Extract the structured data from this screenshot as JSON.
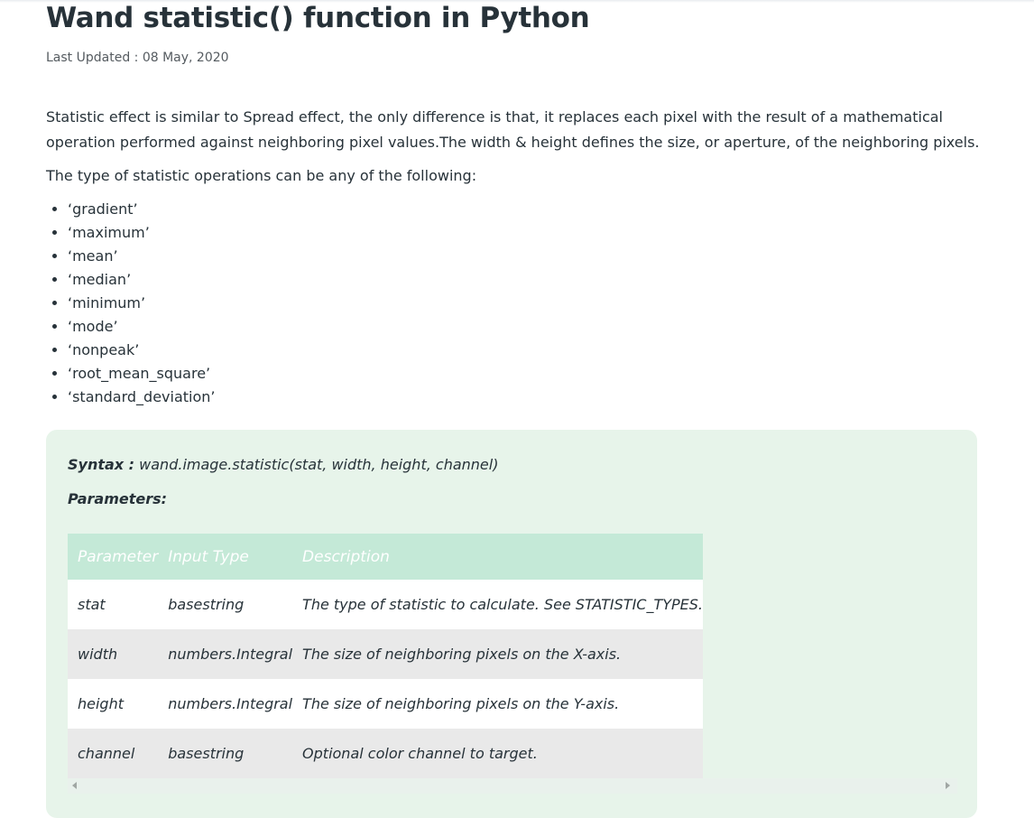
{
  "article": {
    "title": "Wand statistic() function in Python",
    "last_updated": "Last Updated : 08 May, 2020",
    "paragraph1": "Statistic effect is similar to Spread effect, the only difference is that, it replaces each pixel with the result of a mathematical operation performed against neighboring pixel values.The width & height defines the size, or aperture, of the neighboring pixels.",
    "paragraph2": "The type of statistic operations can be any of the following:",
    "stat_types": [
      "‘gradient’",
      "‘maximum’",
      "‘mean’",
      "‘median’",
      "‘minimum’",
      "‘mode’",
      "‘nonpeak’",
      "‘root_mean_square’",
      "‘standard_deviation’"
    ]
  },
  "syntax": {
    "label": "Syntax :",
    "code": " wand.image.statistic(stat, width, height, channel)",
    "params_label": "Parameters:"
  },
  "table": {
    "headers": [
      "Parameter",
      "Input Type",
      "Description"
    ],
    "rows": [
      [
        "stat",
        "basestring",
        "The type of statistic to calculate. See STATISTIC_TYPES."
      ],
      [
        "width",
        "numbers.Integral",
        "The size of neighboring pixels on the X-axis."
      ],
      [
        "height",
        "numbers.Integral",
        "The size of neighboring pixels on the Y-axis."
      ],
      [
        "channel",
        "basestring",
        "Optional color channel to target."
      ]
    ]
  },
  "colors": {
    "text": "#273239",
    "box_bg": "#e7f4ea",
    "table_header_bg": "#c4e9d7"
  }
}
